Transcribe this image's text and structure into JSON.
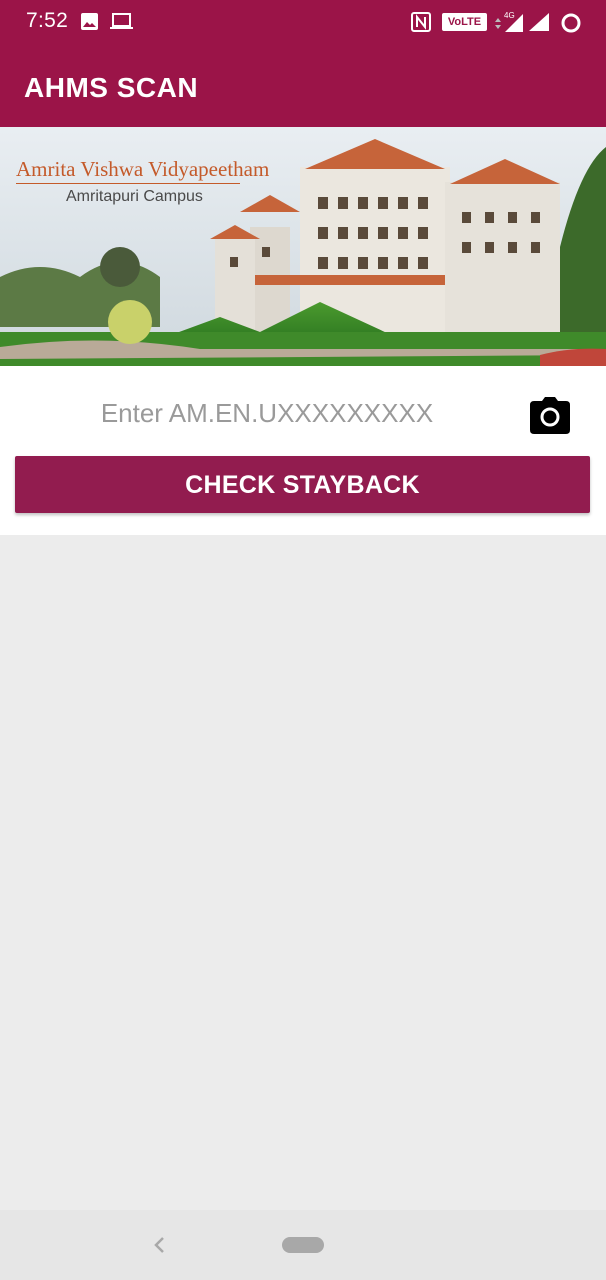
{
  "status_bar": {
    "time": "7:52",
    "icons": [
      "image-icon",
      "laptop-icon",
      "nfc-icon",
      "volte-icon",
      "signal-4g-icon",
      "signal-icon",
      "battery-icon"
    ],
    "volte_label": "VoLTE",
    "network_label": "4G"
  },
  "app_bar": {
    "title": "AHMS SCAN"
  },
  "banner": {
    "title": "Amrita Vishwa Vidyapeetham",
    "subtitle": "Amritapuri Campus"
  },
  "form": {
    "input_placeholder": "Enter AM.EN.UXXXXXXXXX",
    "input_value": "",
    "camera_icon": "camera-icon",
    "check_button_label": "CHECK STAYBACK"
  },
  "nav_bar": {
    "icons": [
      "back-icon",
      "home-pill-icon"
    ]
  },
  "colors": {
    "primary": "#9b1448",
    "button": "#921c4f",
    "background": "#ececec"
  }
}
